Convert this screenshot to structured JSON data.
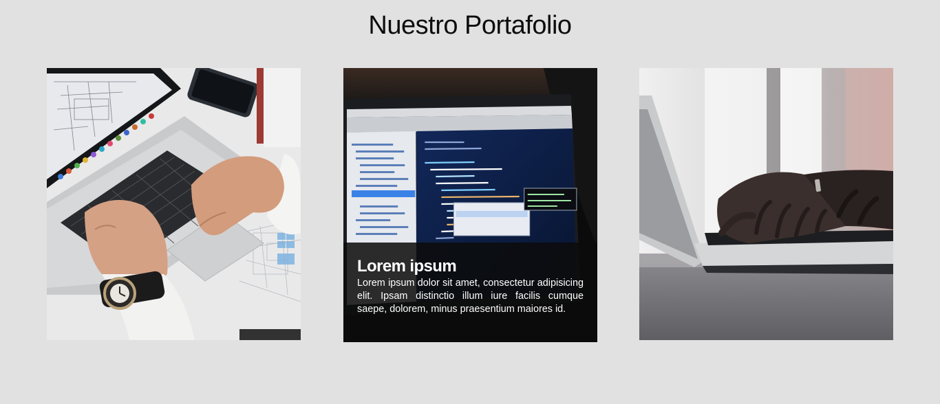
{
  "portfolio": {
    "title": "Nuestro Portafolio",
    "items": [
      {
        "image": "laptop-blueprints-photo"
      },
      {
        "image": "laptop-code-editor-photo",
        "caption_title": "Lorem ipsum",
        "caption_text": "Lorem ipsum dolor sit amet, consectetur adipisicing elit. Ipsam distinctio illum iure facilis cumque saepe, dolorem, minus praesentium maiores id."
      },
      {
        "image": "hands-typing-laptop-photo"
      }
    ]
  },
  "colors": {
    "page_background": "#e1e1e1",
    "overlay_background": "#0c0c0c",
    "title_text": "#0d0d0d"
  }
}
